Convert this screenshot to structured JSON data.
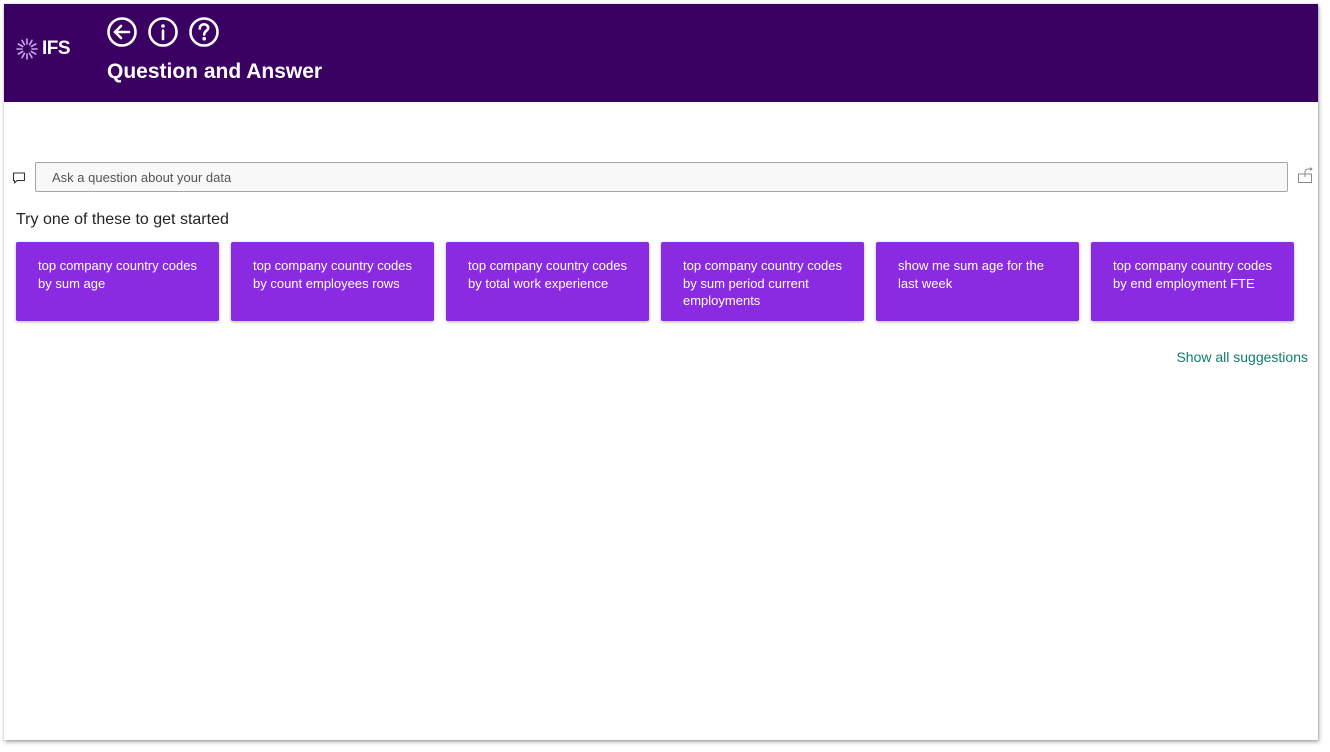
{
  "header": {
    "logo_text": "IFS",
    "title": "Question and Answer",
    "nav_icons": [
      "back-icon",
      "info-icon",
      "help-icon"
    ],
    "background_color": "#3a0062"
  },
  "qa": {
    "search_placeholder": "Ask a question about your data",
    "search_value": "",
    "prompt": "Try one of these to get started",
    "suggestions": [
      "top company country codes by sum age",
      "top company country codes by count employees rows",
      "top company country codes by total work experience",
      "top company country codes by sum period current employments",
      "show me sum age for the last week",
      "top company country codes by end employment FTE"
    ],
    "show_all_label": "Show all suggestions",
    "card_color": "#8a2be2",
    "link_color": "#107c6c"
  }
}
